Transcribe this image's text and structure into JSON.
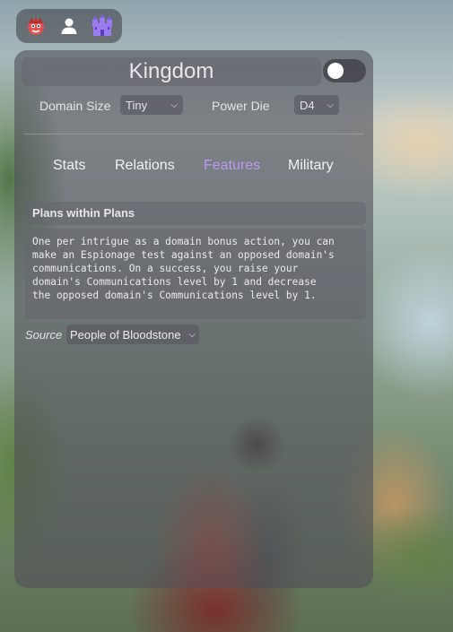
{
  "app": {
    "icons": [
      "monster-face-icon",
      "person-icon",
      "castle-icon"
    ]
  },
  "header": {
    "title": "Kingdom",
    "toggle_on": false
  },
  "settings": {
    "domain_size_label": "Domain Size",
    "domain_size_value": "Tiny",
    "power_die_label": "Power Die",
    "power_die_value": "D4"
  },
  "tabs": [
    {
      "label": "Stats",
      "active": false
    },
    {
      "label": "Relations",
      "active": false
    },
    {
      "label": "Features",
      "active": true
    },
    {
      "label": "Military",
      "active": false
    }
  ],
  "feature": {
    "title": "Plans within Plans",
    "lines": [
      "One per intrigue as a domain bonus action, you can",
      "make an Espionage test against an opposed domain's",
      "communications. On a success, you raise your",
      "domain's Communications level by 1 and decrease",
      "the opposed domain's Communications level by 1."
    ],
    "source_label": "Source",
    "source_value": "People of Bloodstone"
  },
  "colors": {
    "accent": "#b99bf5",
    "monster_icon": "#e0524d",
    "castle_icon": "#9b7cf0"
  }
}
